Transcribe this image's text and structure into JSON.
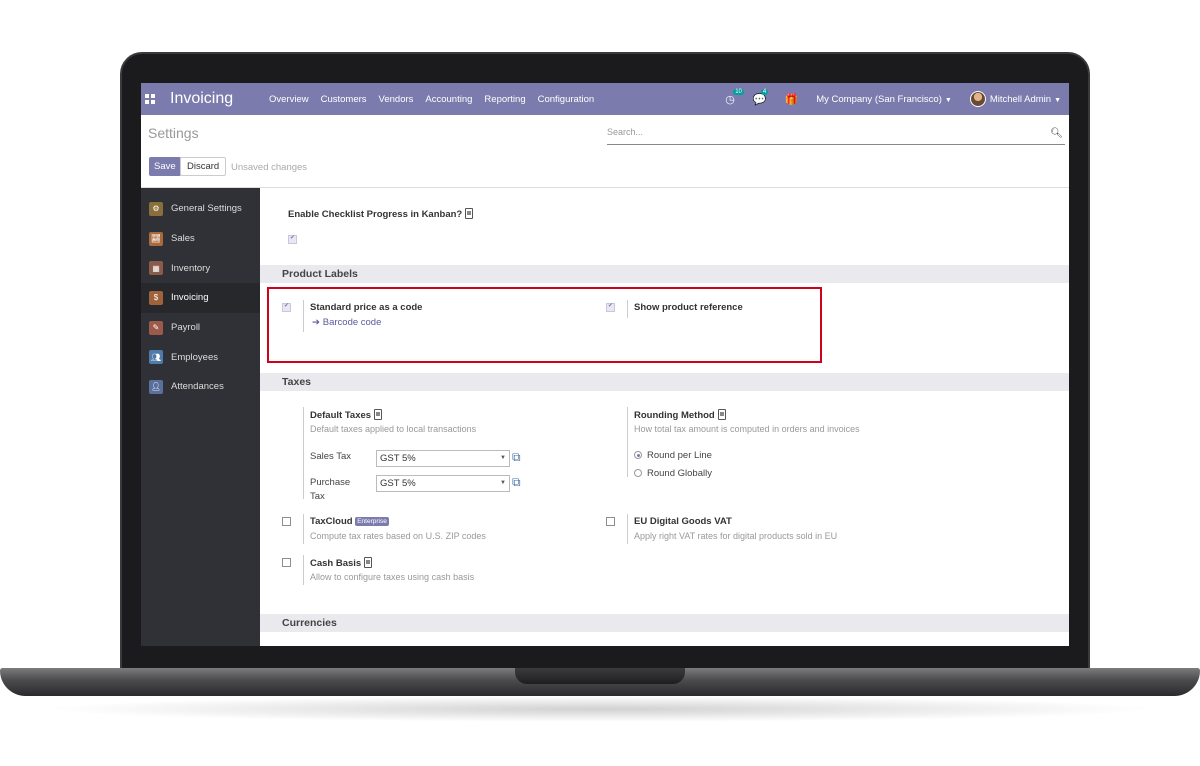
{
  "navbar": {
    "app_title": "Invoicing",
    "menu": [
      "Overview",
      "Customers",
      "Vendors",
      "Accounting",
      "Reporting",
      "Configuration"
    ],
    "activity_count": "10",
    "message_count": "4",
    "company": "My Company (San Francisco)",
    "user": "Mitchell Admin"
  },
  "control_panel": {
    "title": "Settings",
    "search_placeholder": "Search...",
    "save_label": "Save",
    "discard_label": "Discard",
    "status": "Unsaved changes"
  },
  "sidebar": {
    "items": [
      {
        "label": "General Settings",
        "icon": "gear-icon",
        "color": "#8b6f3a"
      },
      {
        "label": "Sales",
        "icon": "chart-icon",
        "color": "#a86a3d"
      },
      {
        "label": "Inventory",
        "icon": "box-icon",
        "color": "#8a5a4a"
      },
      {
        "label": "Invoicing",
        "icon": "invoice-icon",
        "color": "#a0623a"
      },
      {
        "label": "Payroll",
        "icon": "payroll-icon",
        "color": "#9c5a4a"
      },
      {
        "label": "Employees",
        "icon": "users-icon",
        "color": "#4f7ba8"
      },
      {
        "label": "Attendances",
        "icon": "attendance-icon",
        "color": "#5a6f9e"
      }
    ],
    "active": "Invoicing"
  },
  "kanban": {
    "label": "Enable Checklist Progress in Kanban?",
    "checked": true
  },
  "product_labels": {
    "heading": "Product Labels",
    "standard_price_label": "Standard price as a code",
    "standard_price_checked": true,
    "barcode_link": "Barcode code",
    "show_reference_label": "Show product reference",
    "show_reference_checked": true
  },
  "taxes": {
    "heading": "Taxes",
    "default_taxes_label": "Default Taxes",
    "default_taxes_desc": "Default taxes applied to local transactions",
    "sales_tax_label": "Sales Tax",
    "sales_tax_value": "GST 5%",
    "purchase_tax_label_1": "Purchase",
    "purchase_tax_label_2": "Tax",
    "purchase_tax_value": "GST 5%",
    "rounding_label": "Rounding Method",
    "rounding_desc": "How total tax amount is computed in orders and invoices",
    "round_per_line": "Round per Line",
    "round_globally": "Round Globally",
    "rounding_selected": "Round per Line",
    "taxcloud_label": "TaxCloud",
    "taxcloud_badge": "Enterprise",
    "taxcloud_desc": "Compute tax rates based on U.S. ZIP codes",
    "eu_label": "EU Digital Goods VAT",
    "eu_desc": "Apply right VAT rates for digital products sold in EU",
    "cash_basis_label": "Cash Basis",
    "cash_basis_desc": "Allow to configure taxes using cash basis"
  },
  "currencies": {
    "heading": "Currencies"
  },
  "colors": {
    "brand": "#7c7bad",
    "sidebar_bg": "#2f3136",
    "highlight": "#d0021b"
  }
}
